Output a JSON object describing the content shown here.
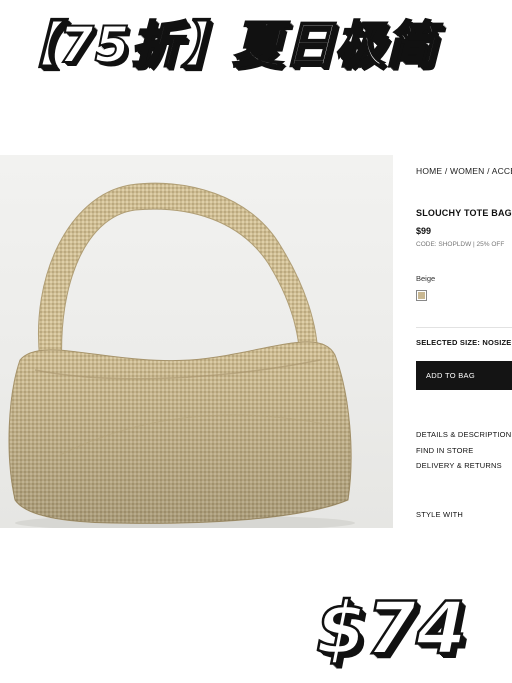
{
  "banner": {
    "text": "【75折】夏日极简"
  },
  "product": {
    "image_alt": "Crochet raffia slouchy tote bag in beige",
    "breadcrumb": "HOME / WOMEN / ACCESSORIES",
    "title": "SLOUCHY TOTE BAG",
    "price": "$99",
    "code": "CODE: SHOPLDW | 25% OFF",
    "color_label": "Beige",
    "swatch_color": "#c9b892",
    "selected_size": "SELECTED SIZE: NOSIZE",
    "add_to_bag": "ADD TO BAG",
    "links": [
      "DETAILS & DESCRIPTION",
      "FIND IN STORE",
      "DELIVERY & RETURNS"
    ],
    "style_with": "STYLE WITH"
  },
  "sale": {
    "price": "$74"
  }
}
